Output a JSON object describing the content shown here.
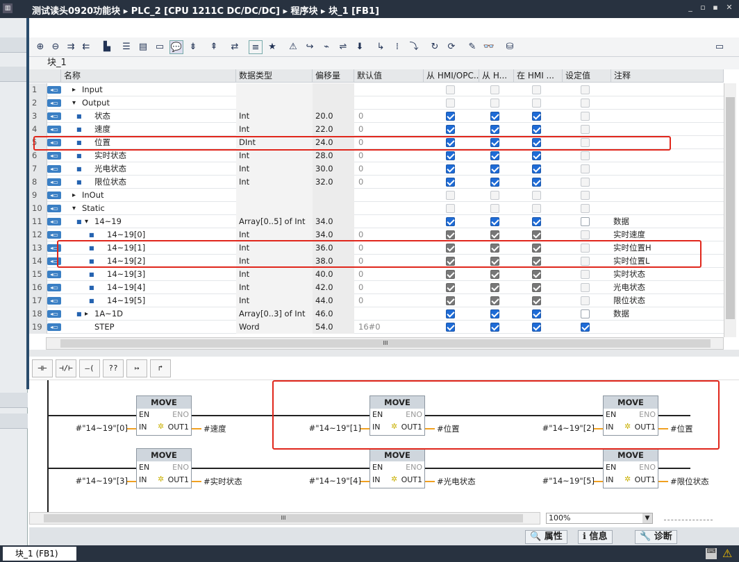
{
  "title": "测试读头0920功能块 ▸ PLC_2 [CPU 1211C DC/DC/DC] ▸ 程序块 ▸ 块_1 [FB1]",
  "block_name": "块_1",
  "columns": [
    "名称",
    "数据类型",
    "偏移量",
    "默认值",
    "从 HMI/OPC...",
    "从 H...",
    "在 HMI ...",
    "设定值",
    "注释"
  ],
  "rows": [
    {
      "n": "1",
      "name": "Input",
      "type": "",
      "off": "",
      "def": "",
      "c": [
        "dis",
        "dis",
        "dis",
        "dis"
      ],
      "note": "",
      "exp": "▸",
      "lvl": 0,
      "sq": false
    },
    {
      "n": "2",
      "name": "Output",
      "type": "",
      "off": "",
      "def": "",
      "c": [
        "dis",
        "dis",
        "dis",
        "dis"
      ],
      "note": "",
      "exp": "▾",
      "lvl": 0,
      "sq": false
    },
    {
      "n": "3",
      "name": "状态",
      "type": "Int",
      "off": "20.0",
      "def": "0",
      "c": [
        "on",
        "on",
        "on",
        "dis"
      ],
      "note": "",
      "exp": "",
      "lvl": 1,
      "sq": true
    },
    {
      "n": "4",
      "name": "速度",
      "type": "Int",
      "off": "22.0",
      "def": "0",
      "c": [
        "on",
        "on",
        "on",
        "dis"
      ],
      "note": "",
      "exp": "",
      "lvl": 1,
      "sq": true
    },
    {
      "n": "5",
      "name": "位置",
      "type": "DInt",
      "off": "24.0",
      "def": "0",
      "c": [
        "on",
        "on",
        "on",
        "dis"
      ],
      "note": "",
      "exp": "",
      "lvl": 1,
      "sq": true
    },
    {
      "n": "6",
      "name": "实时状态",
      "type": "Int",
      "off": "28.0",
      "def": "0",
      "c": [
        "on",
        "on",
        "on",
        "dis"
      ],
      "note": "",
      "exp": "",
      "lvl": 1,
      "sq": true
    },
    {
      "n": "7",
      "name": "光电状态",
      "type": "Int",
      "off": "30.0",
      "def": "0",
      "c": [
        "on",
        "on",
        "on",
        "dis"
      ],
      "note": "",
      "exp": "",
      "lvl": 1,
      "sq": true
    },
    {
      "n": "8",
      "name": "限位状态",
      "type": "Int",
      "off": "32.0",
      "def": "0",
      "c": [
        "on",
        "on",
        "on",
        "dis"
      ],
      "note": "",
      "exp": "",
      "lvl": 1,
      "sq": true
    },
    {
      "n": "9",
      "name": "InOut",
      "type": "",
      "off": "",
      "def": "",
      "c": [
        "dis",
        "dis",
        "dis",
        "dis"
      ],
      "note": "",
      "exp": "▸",
      "lvl": 0,
      "sq": false
    },
    {
      "n": "10",
      "name": "Static",
      "type": "",
      "off": "",
      "def": "",
      "c": [
        "dis",
        "dis",
        "dis",
        "dis"
      ],
      "note": "",
      "exp": "▾",
      "lvl": 0,
      "sq": false
    },
    {
      "n": "11",
      "name": "14~19",
      "type": "Array[0..5] of Int",
      "off": "34.0",
      "def": "",
      "c": [
        "on",
        "on",
        "on",
        "off"
      ],
      "note": "数据",
      "exp": "▾",
      "lvl": 1,
      "sq": true
    },
    {
      "n": "12",
      "name": "14~19[0]",
      "type": "Int",
      "off": "34.0",
      "def": "0",
      "c": [
        "ong",
        "ong",
        "ong",
        "dis"
      ],
      "note": "实时速度",
      "exp": "",
      "lvl": 2,
      "sq": true
    },
    {
      "n": "13",
      "name": "14~19[1]",
      "type": "Int",
      "off": "36.0",
      "def": "0",
      "c": [
        "ong",
        "ong",
        "ong",
        "dis"
      ],
      "note": "实时位置H",
      "exp": "",
      "lvl": 2,
      "sq": true
    },
    {
      "n": "14",
      "name": "14~19[2]",
      "type": "Int",
      "off": "38.0",
      "def": "0",
      "c": [
        "ong",
        "ong",
        "ong",
        "dis"
      ],
      "note": "实时位置L",
      "exp": "",
      "lvl": 2,
      "sq": true
    },
    {
      "n": "15",
      "name": "14~19[3]",
      "type": "Int",
      "off": "40.0",
      "def": "0",
      "c": [
        "ong",
        "ong",
        "ong",
        "dis"
      ],
      "note": "实时状态",
      "exp": "",
      "lvl": 2,
      "sq": true
    },
    {
      "n": "16",
      "name": "14~19[4]",
      "type": "Int",
      "off": "42.0",
      "def": "0",
      "c": [
        "ong",
        "ong",
        "ong",
        "dis"
      ],
      "note": "光电状态",
      "exp": "",
      "lvl": 2,
      "sq": true
    },
    {
      "n": "17",
      "name": "14~19[5]",
      "type": "Int",
      "off": "44.0",
      "def": "0",
      "c": [
        "ong",
        "ong",
        "ong",
        "dis"
      ],
      "note": "限位状态",
      "exp": "",
      "lvl": 2,
      "sq": true
    },
    {
      "n": "18",
      "name": "1A~1D",
      "type": "Array[0..3] of Int",
      "off": "46.0",
      "def": "",
      "c": [
        "on",
        "on",
        "on",
        "off"
      ],
      "note": "数据",
      "exp": "▸",
      "lvl": 1,
      "sq": true
    },
    {
      "n": "19",
      "name": "STEP",
      "type": "Word",
      "off": "54.0",
      "def": "16#0",
      "c": [
        "on",
        "on",
        "on",
        "on"
      ],
      "note": "",
      "exp": "",
      "lvl": 1,
      "sq": false
    }
  ],
  "ladder_tools": [
    "⊣⊢",
    "⊣/⊢",
    "–( )–",
    "??",
    "↦",
    "↱"
  ],
  "moves": [
    {
      "title": "MOVE",
      "in": "#\"14~19\"[0]",
      "out": "#速度"
    },
    {
      "title": "MOVE",
      "in": "#\"14~19\"[1]",
      "out": "#位置"
    },
    {
      "title": "MOVE",
      "in": "#\"14~19\"[2]",
      "out": "#位置"
    },
    {
      "title": "MOVE",
      "in": "#\"14~19\"[3]",
      "out": "#实时状态"
    },
    {
      "title": "MOVE",
      "in": "#\"14~19\"[4]",
      "out": "#光电状态"
    },
    {
      "title": "MOVE",
      "in": "#\"14~19\"[5]",
      "out": "#限位状态"
    }
  ],
  "pins": {
    "en": "EN",
    "eno": "ENO",
    "in": "IN",
    "out": "OUT1"
  },
  "zoom": "100%",
  "bottom_tabs": [
    "属性",
    "信息",
    "诊断"
  ],
  "status_tab": "块_1 (FB1)",
  "scroll_mark": "lll"
}
